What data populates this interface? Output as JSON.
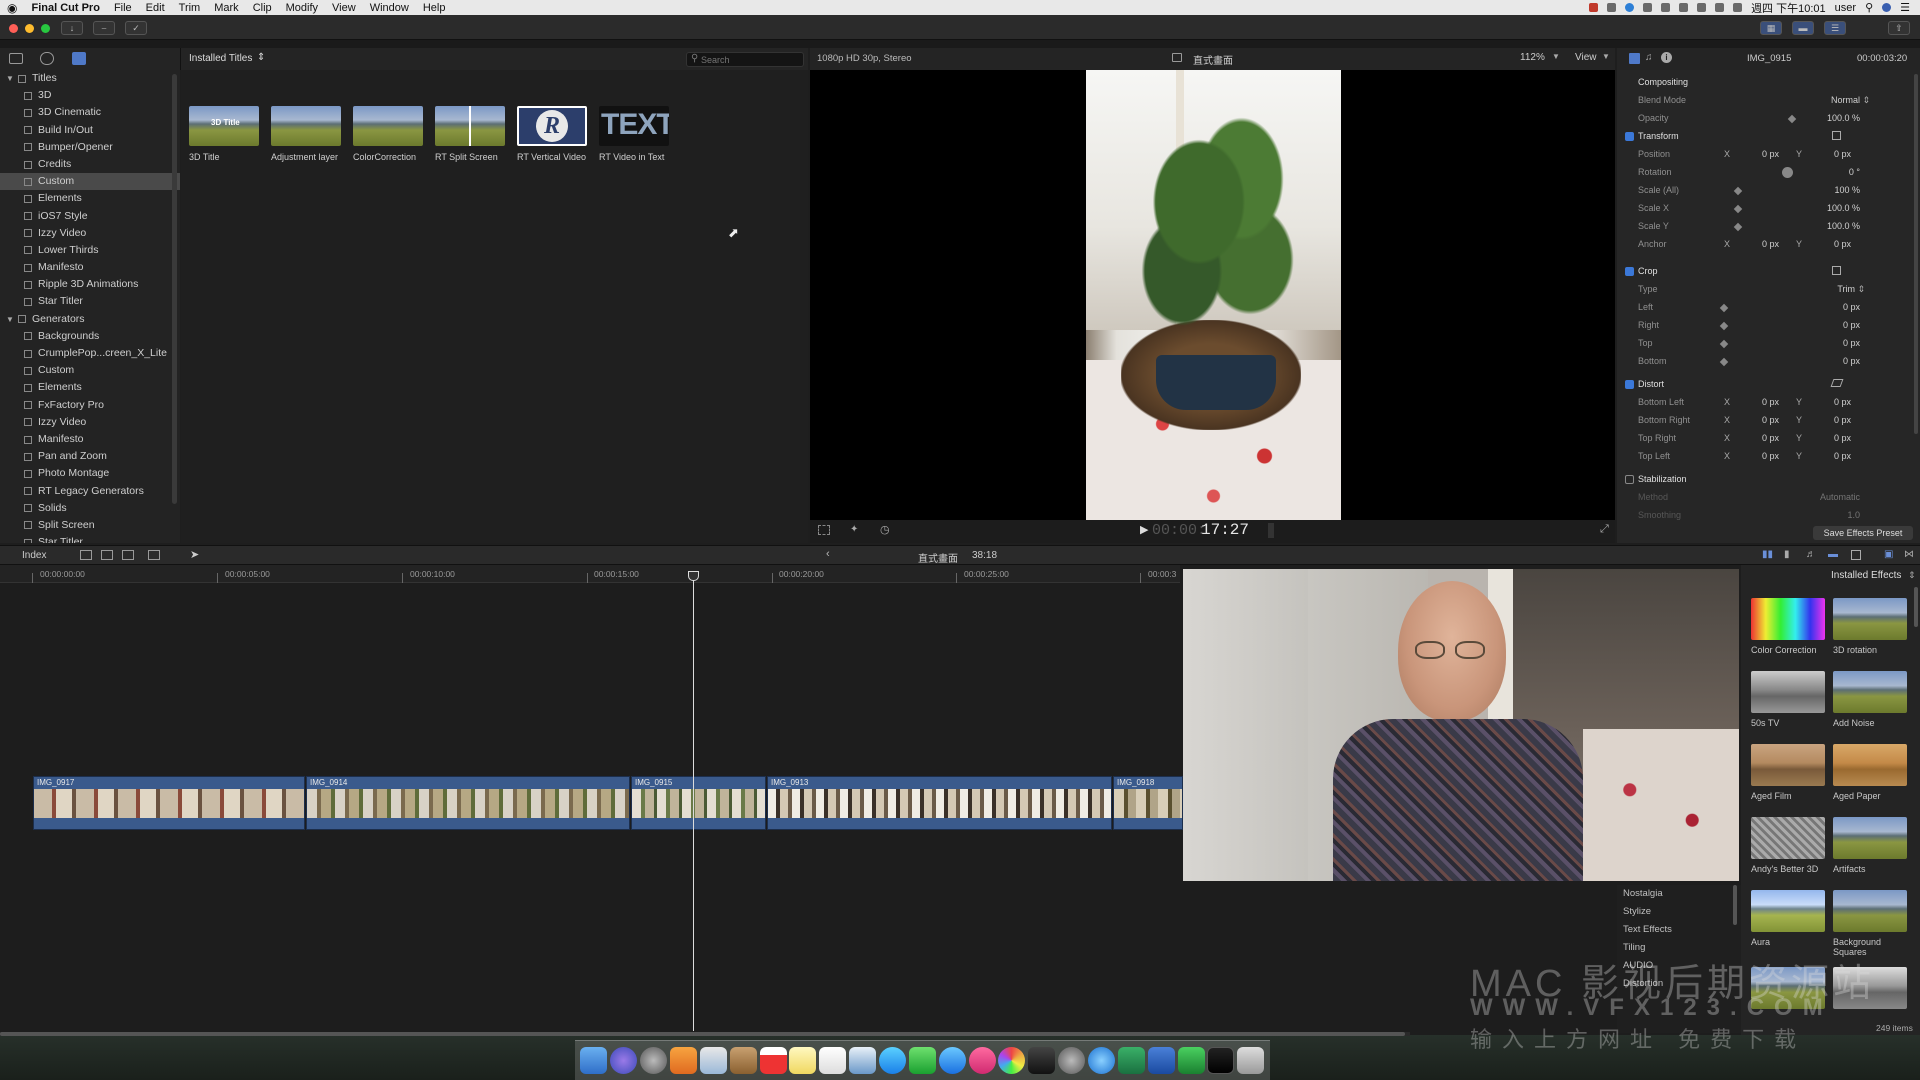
{
  "menubar": {
    "apple": "",
    "app_name": "Final Cut Pro",
    "menus": [
      "File",
      "Edit",
      "Trim",
      "Mark",
      "Clip",
      "Modify",
      "View",
      "Window",
      "Help"
    ],
    "clock": "週四 下午10:01",
    "user": "user"
  },
  "browser": {
    "library_popup": "Installed Titles",
    "search_placeholder": "Search",
    "titles_section": "Titles",
    "titles": [
      "3D",
      "3D Cinematic",
      "Build In/Out",
      "Bumper/Opener",
      "Credits",
      "Custom",
      "Elements",
      "iOS7 Style",
      "Izzy Video",
      "Lower Thirds",
      "Manifesto",
      "Ripple 3D Animations",
      "Star Titler"
    ],
    "selected_title": "Custom",
    "generators_section": "Generators",
    "generators": [
      "Backgrounds",
      "CrumplePop...creen_X_Lite",
      "Custom",
      "Elements",
      "FxFactory Pro",
      "Izzy Video",
      "Manifesto",
      "Pan and Zoom",
      "Photo Montage",
      "RT Legacy Generators",
      "Solids",
      "Split Screen",
      "Star Titler"
    ],
    "items": [
      "3D Title",
      "Adjustment layer",
      "ColorCorrection",
      "RT Split Screen",
      "RT Vertical Video",
      "RT Video in Text"
    ],
    "thumb_text_r": "R",
    "thumb_text_text": "TEXT",
    "thumb_text_3d": "3D Title"
  },
  "viewer": {
    "format": "1080p HD 30p, Stereo",
    "project": "直式畫面",
    "zoom": "112%",
    "view_menu": "View",
    "timecode_dim": "00:00:",
    "timecode": "17:27"
  },
  "inspector": {
    "clip_name": "IMG_0915",
    "duration": "00:00:03:20",
    "compositing": "Compositing",
    "blend_mode_label": "Blend Mode",
    "blend_mode": "Normal",
    "opacity_label": "Opacity",
    "opacity": "100.0 %",
    "transform": "Transform",
    "position_label": "Position",
    "rotation_label": "Rotation",
    "rotation": "0 °",
    "scale_all_label": "Scale (All)",
    "scale_all": "100 %",
    "scale_x_label": "Scale X",
    "scale_x": "100.0 %",
    "scale_y_label": "Scale Y",
    "scale_y": "100.0 %",
    "anchor_label": "Anchor",
    "crop": "Crop",
    "type_label": "Type",
    "type": "Trim",
    "left_label": "Left",
    "right_label": "Right",
    "top_label": "Top",
    "bottom_label": "Bottom",
    "distort": "Distort",
    "bottom_left_label": "Bottom Left",
    "bottom_right_label": "Bottom Right",
    "top_right_label": "Top Right",
    "top_left_label": "Top Left",
    "stabilization": "Stabilization",
    "method_label": "Method",
    "method": "Automatic",
    "smoothing_label": "Smoothing",
    "smoothing": "1.0",
    "x": "X",
    "y": "Y",
    "zero_px": "0 px",
    "save_preset": "Save Effects Preset"
  },
  "timeline": {
    "index": "Index",
    "project": "直式畫面",
    "duration": "38:18",
    "ruler": [
      "00:00:00:00",
      "00:00:05:00",
      "00:00:10:00",
      "00:00:15:00",
      "00:00:20:00",
      "00:00:25:00",
      "00:00:3"
    ],
    "clips": [
      "IMG_0917",
      "IMG_0914",
      "IMG_0915",
      "IMG_0913",
      "IMG_0918"
    ]
  },
  "effects": {
    "header": "Installed Effects",
    "items": [
      "Color Correction",
      "3D rotation",
      "50s TV",
      "Add Noise",
      "Aged Film",
      "Aged Paper",
      "Andy's Better 3D",
      "Artifacts",
      "Aura",
      "Background Squares"
    ],
    "categories": [
      "Nostalgia",
      "Stylize",
      "Text Effects",
      "Tiling",
      "AUDIO",
      "Distortion"
    ],
    "count": "249 items"
  },
  "watermark": {
    "line1": "MAC 影视后期资源站",
    "line2": "WWW.VFX123.COM",
    "line3": "输入上方网址 免费下载"
  }
}
